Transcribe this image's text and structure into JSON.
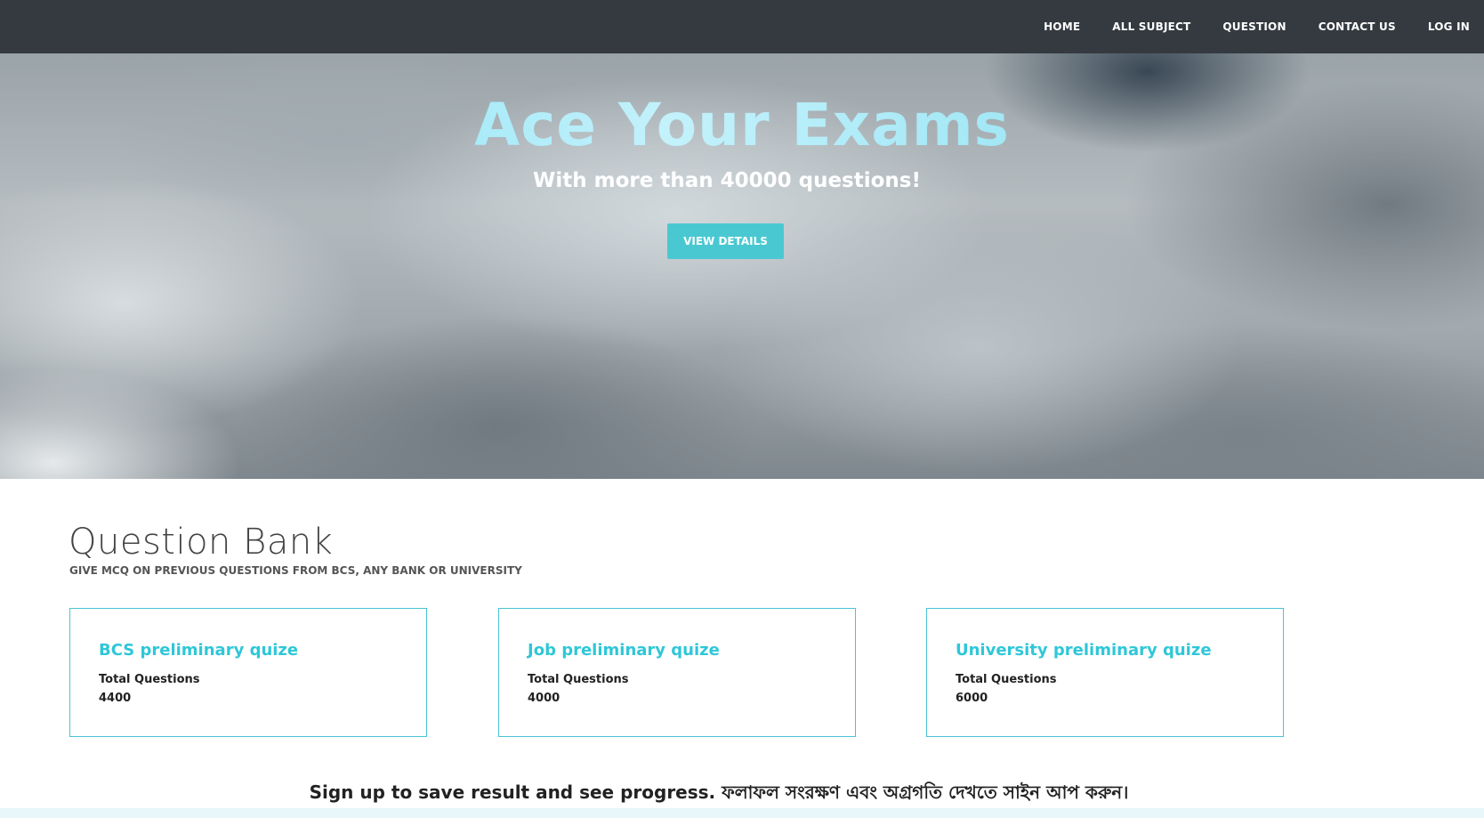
{
  "nav": {
    "items": [
      {
        "label": "HOME"
      },
      {
        "label": "ALL SUBJECT"
      },
      {
        "label": "QUESTION"
      },
      {
        "label": "CONTACT US"
      },
      {
        "label": "LOG IN"
      }
    ]
  },
  "hero": {
    "title": "Ace Your Exams",
    "subtitle": "With more than 40000 questions!",
    "button_label": "VIEW DETAILS"
  },
  "question_bank": {
    "title": "Question Bank",
    "subtitle": "GIVE MCQ ON PREVIOUS QUESTIONS FROM BCS, ANY BANK OR UNIVERSITY",
    "cards": [
      {
        "title": "BCS preliminary quize",
        "label": "Total Questions",
        "count": "4400"
      },
      {
        "title": "Job preliminary quize",
        "label": "Total Questions",
        "count": "4000"
      },
      {
        "title": "University preliminary quize",
        "label": "Total Questions",
        "count": "6000"
      }
    ]
  },
  "signup_text": "Sign up to save result and see progress. ফলাফল সংরক্ষণ এবং অগ্রগতি দেখতে সাইন আপ করুন।",
  "colors": {
    "navbar": "#343a40",
    "accent": "#4ac8d1",
    "card_title": "#2ec7d8",
    "card_border": "#4ac3d6"
  }
}
